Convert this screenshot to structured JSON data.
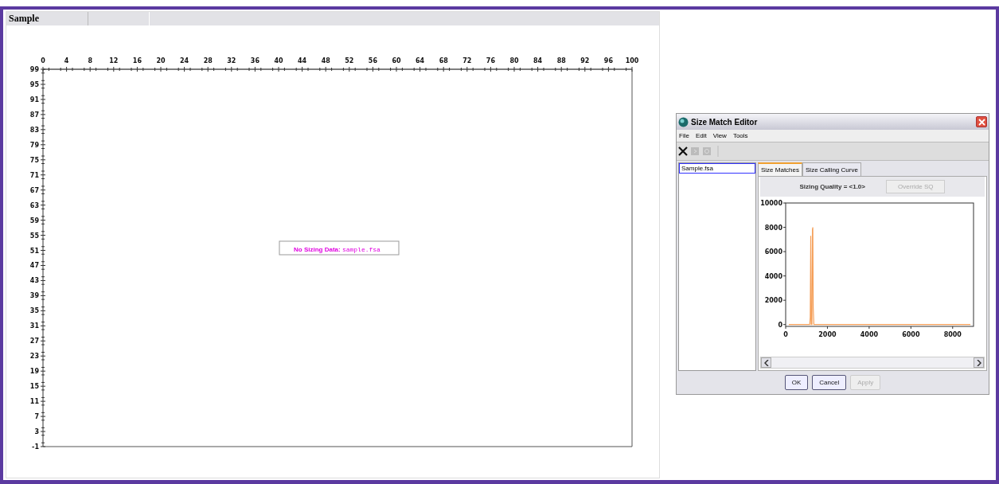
{
  "document": {
    "title": "Sample"
  },
  "plot": {
    "x_ticks": [
      "0",
      "4",
      "8",
      "12",
      "16",
      "20",
      "24",
      "28",
      "32",
      "36",
      "40",
      "44",
      "48",
      "52",
      "56",
      "60",
      "64",
      "68",
      "72",
      "76",
      "80",
      "84",
      "88",
      "92",
      "96",
      "100"
    ],
    "y_ticks": [
      "99",
      "95",
      "91",
      "87",
      "83",
      "79",
      "75",
      "71",
      "67",
      "63",
      "59",
      "55",
      "51",
      "47",
      "43",
      "39",
      "35",
      "31",
      "27",
      "23",
      "19",
      "15",
      "11",
      "7",
      "3",
      "-1"
    ]
  },
  "message": {
    "label": "No Sizing Data:",
    "file": "sample.fsa"
  },
  "dialog": {
    "title": "Size Match Editor",
    "menu": [
      "File",
      "Edit",
      "View",
      "Tools"
    ],
    "toolbar": [
      {
        "kind": "delete",
        "disabled": false
      },
      {
        "kind": "export",
        "disabled": true
      },
      {
        "kind": "image",
        "disabled": true
      }
    ],
    "files": [
      {
        "label": "Sample.fsa",
        "selected": true
      }
    ],
    "tabs": [
      {
        "label": "Size Matches",
        "selected": true
      },
      {
        "label": "Size Calling Curve",
        "selected": false
      }
    ],
    "quality": "Sizing Quality = <1.0>",
    "override_button": {
      "label": "Override SQ",
      "disabled": true
    },
    "chart_data": {
      "type": "line",
      "x": [
        150,
        1150,
        1180,
        1200,
        1220,
        1260,
        1280,
        1300,
        1320,
        1350,
        8850
      ],
      "series": [
        {
          "color": "#f5a05a",
          "values": [
            0,
            0,
            600,
            7300,
            0,
            0,
            7800,
            8000,
            1400,
            0,
            0
          ]
        }
      ],
      "xlim": [
        0,
        9000
      ],
      "ylim": [
        -150,
        10000
      ],
      "xticks": [
        0,
        2000,
        4000,
        6000,
        8000
      ],
      "yticks": [
        0,
        2000,
        4000,
        6000,
        8000,
        10000
      ]
    },
    "buttons": [
      {
        "label": "OK",
        "disabled": false
      },
      {
        "label": "Cancel",
        "disabled": false
      },
      {
        "label": "Apply",
        "disabled": true
      }
    ]
  }
}
